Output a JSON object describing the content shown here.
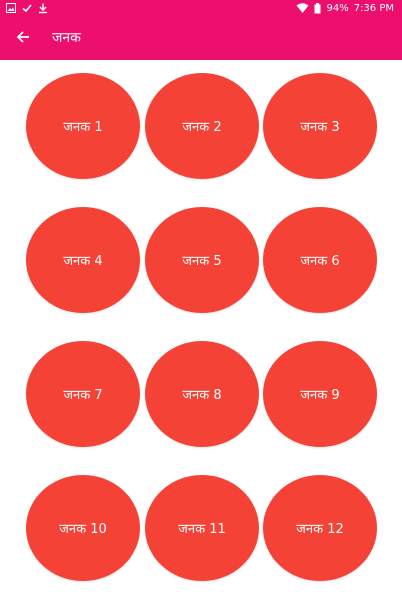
{
  "status_bar": {
    "battery_percent": "94%",
    "time": "7:36 PM",
    "left_icons": [
      "image-icon",
      "check-icon",
      "download-icon"
    ],
    "right_icons": [
      "wifi-icon",
      "battery-icon"
    ]
  },
  "app_bar": {
    "title": "जनक",
    "back_icon": "arrow-left-icon"
  },
  "items": [
    "जनक 1",
    "जनक 2",
    "जनक 3",
    "जनक 4",
    "जनक 5",
    "जनक 6",
    "जनक 7",
    "जनक 8",
    "जनक 9",
    "जनक 10",
    "जनक 11",
    "जनक 12"
  ],
  "colors": {
    "app_bar": "#ec0f6e",
    "button_fill": "#f44336",
    "button_text": "#ffffff",
    "background": "#ffffff"
  }
}
